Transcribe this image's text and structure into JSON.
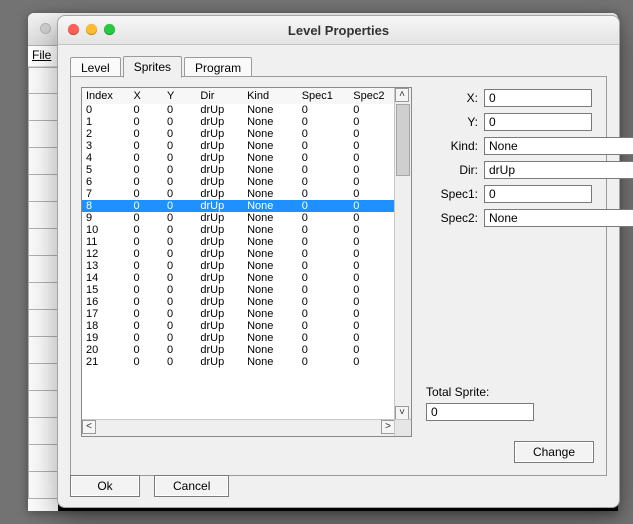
{
  "bg_window": {
    "menu_file": "File"
  },
  "dialog": {
    "title": "Level Properties",
    "tabs": {
      "level": "Level",
      "sprites": "Sprites",
      "program": "Program"
    },
    "table": {
      "headers": {
        "index": "Index",
        "x": "X",
        "y": "Y",
        "dir": "Dir",
        "kind": "Kind",
        "spec1": "Spec1",
        "spec2": "Spec2"
      },
      "selected_index": 8,
      "rows": [
        {
          "index": 0,
          "x": 0,
          "y": 0,
          "dir": "drUp",
          "kind": "None",
          "s1": 0,
          "s2": 0
        },
        {
          "index": 1,
          "x": 0,
          "y": 0,
          "dir": "drUp",
          "kind": "None",
          "s1": 0,
          "s2": 0
        },
        {
          "index": 2,
          "x": 0,
          "y": 0,
          "dir": "drUp",
          "kind": "None",
          "s1": 0,
          "s2": 0
        },
        {
          "index": 3,
          "x": 0,
          "y": 0,
          "dir": "drUp",
          "kind": "None",
          "s1": 0,
          "s2": 0
        },
        {
          "index": 4,
          "x": 0,
          "y": 0,
          "dir": "drUp",
          "kind": "None",
          "s1": 0,
          "s2": 0
        },
        {
          "index": 5,
          "x": 0,
          "y": 0,
          "dir": "drUp",
          "kind": "None",
          "s1": 0,
          "s2": 0
        },
        {
          "index": 6,
          "x": 0,
          "y": 0,
          "dir": "drUp",
          "kind": "None",
          "s1": 0,
          "s2": 0
        },
        {
          "index": 7,
          "x": 0,
          "y": 0,
          "dir": "drUp",
          "kind": "None",
          "s1": 0,
          "s2": 0
        },
        {
          "index": 8,
          "x": 0,
          "y": 0,
          "dir": "drUp",
          "kind": "None",
          "s1": 0,
          "s2": 0
        },
        {
          "index": 9,
          "x": 0,
          "y": 0,
          "dir": "drUp",
          "kind": "None",
          "s1": 0,
          "s2": 0
        },
        {
          "index": 10,
          "x": 0,
          "y": 0,
          "dir": "drUp",
          "kind": "None",
          "s1": 0,
          "s2": 0
        },
        {
          "index": 11,
          "x": 0,
          "y": 0,
          "dir": "drUp",
          "kind": "None",
          "s1": 0,
          "s2": 0
        },
        {
          "index": 12,
          "x": 0,
          "y": 0,
          "dir": "drUp",
          "kind": "None",
          "s1": 0,
          "s2": 0
        },
        {
          "index": 13,
          "x": 0,
          "y": 0,
          "dir": "drUp",
          "kind": "None",
          "s1": 0,
          "s2": 0
        },
        {
          "index": 14,
          "x": 0,
          "y": 0,
          "dir": "drUp",
          "kind": "None",
          "s1": 0,
          "s2": 0
        },
        {
          "index": 15,
          "x": 0,
          "y": 0,
          "dir": "drUp",
          "kind": "None",
          "s1": 0,
          "s2": 0
        },
        {
          "index": 16,
          "x": 0,
          "y": 0,
          "dir": "drUp",
          "kind": "None",
          "s1": 0,
          "s2": 0
        },
        {
          "index": 17,
          "x": 0,
          "y": 0,
          "dir": "drUp",
          "kind": "None",
          "s1": 0,
          "s2": 0
        },
        {
          "index": 18,
          "x": 0,
          "y": 0,
          "dir": "drUp",
          "kind": "None",
          "s1": 0,
          "s2": 0
        },
        {
          "index": 19,
          "x": 0,
          "y": 0,
          "dir": "drUp",
          "kind": "None",
          "s1": 0,
          "s2": 0
        },
        {
          "index": 20,
          "x": 0,
          "y": 0,
          "dir": "drUp",
          "kind": "None",
          "s1": 0,
          "s2": 0
        },
        {
          "index": 21,
          "x": 0,
          "y": 0,
          "dir": "drUp",
          "kind": "None",
          "s1": 0,
          "s2": 0
        }
      ]
    },
    "form": {
      "x_label": "X:",
      "x_value": "0",
      "y_label": "Y:",
      "y_value": "0",
      "kind_label": "Kind:",
      "kind_value": "None",
      "dir_label": "Dir:",
      "dir_value": "drUp",
      "spec1_label": "Spec1:",
      "spec1_value": "0",
      "spec2_label": "Spec2:",
      "spec2_value": "None",
      "total_sprite_label": "Total Sprite:",
      "total_sprite_value": "0",
      "change_label": "Change"
    },
    "buttons": {
      "ok": "Ok",
      "cancel": "Cancel"
    }
  }
}
